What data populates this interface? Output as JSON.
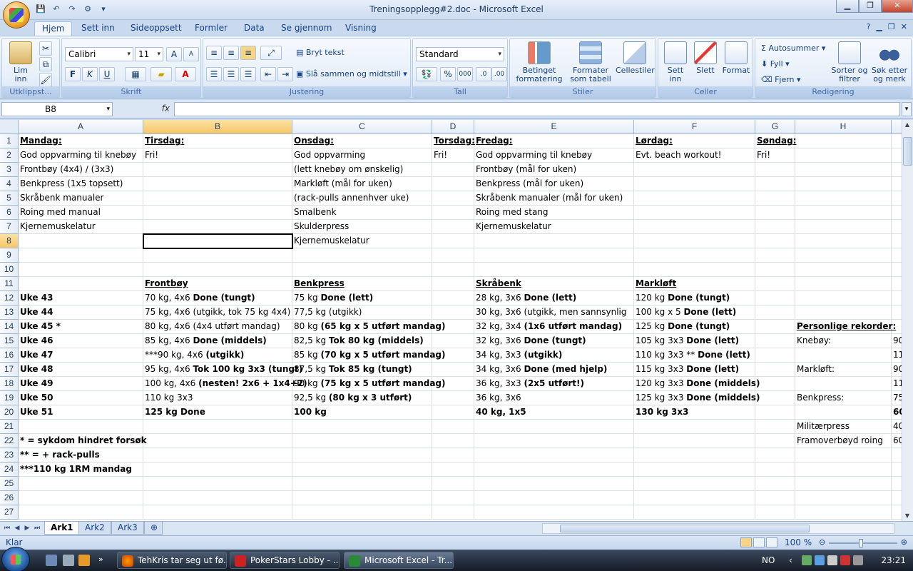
{
  "window": {
    "title": "Treningsopplegg#2.doc - Microsoft Excel",
    "min_label": "▁",
    "max_label": "❐",
    "close_label": "✕"
  },
  "qat": {
    "save": "💾",
    "undo": "↶",
    "redo": "↷",
    "custom": "⚙",
    "more": "▾"
  },
  "tabs": [
    "Hjem",
    "Sett inn",
    "Sideoppsett",
    "Formler",
    "Data",
    "Se gjennom",
    "Visning"
  ],
  "ribbon": {
    "clipboard": {
      "label": "Utklippst...",
      "paste": "Lim inn"
    },
    "font": {
      "label": "Skrift",
      "name": "Calibri",
      "size": "11",
      "bold": "F",
      "italic": "K",
      "underline": "U",
      "grow": "A",
      "shrink": "A"
    },
    "alignment": {
      "label": "Justering",
      "wrap": "Bryt tekst",
      "merge": "Slå sammen og midtstill"
    },
    "number": {
      "label": "Tall",
      "format": "Standard",
      "percent": "%",
      "thousands": "000"
    },
    "styles": {
      "label": "Stiler",
      "conditional": "Betinget formatering",
      "table": "Formater som tabell",
      "cell": "Cellestiler"
    },
    "cells": {
      "label": "Celler",
      "insert": "Sett inn",
      "delete": "Slett",
      "format": "Format"
    },
    "editing": {
      "label": "Redigering",
      "autosum": "Autosummer",
      "fill": "Fyll",
      "clear": "Fjern",
      "sort": "Sorter og filtrer",
      "find": "Søk etter og merk"
    }
  },
  "formula_bar": {
    "namebox": "B8",
    "fx": "fx",
    "value": ""
  },
  "columns": [
    "A",
    "B",
    "C",
    "D",
    "E",
    "F",
    "G",
    "H"
  ],
  "rows": [
    [
      "Mandag:",
      "Tirsdag:",
      "Onsdag:",
      "Torsdag:",
      "Fredag:",
      "Lørdag:",
      "Søndag:",
      "",
      ""
    ],
    [
      "God oppvarming til knebøy",
      "Fri!",
      "God oppvarming",
      "Fri!",
      "God oppvarming til knebøy",
      "Evt. beach workout!",
      "Fri!",
      "",
      ""
    ],
    [
      "Frontbøy (4x4) / (3x3)",
      "",
      "(lett knebøy om ønskelig)",
      "",
      "Frontbøy (mål for uken)",
      "",
      "",
      "",
      ""
    ],
    [
      "Benkpress (1x5 topsett)",
      "",
      "Markløft (mål for uken)",
      "",
      "Benkpress (mål for uken)",
      "",
      "",
      "",
      ""
    ],
    [
      "Skråbenk manualer",
      "",
      "(rack-pulls annenhver uke)",
      "",
      "Skråbenk manualer (mål for uken)",
      "",
      "",
      "",
      ""
    ],
    [
      "Roing med manual",
      "",
      "Smalbenk",
      "",
      "Roing med stang",
      "",
      "",
      "",
      ""
    ],
    [
      "Kjernemuskelatur",
      "",
      "Skulderpress",
      "",
      "Kjernemuskelatur",
      "",
      "",
      "",
      ""
    ],
    [
      "",
      "",
      "Kjernemuskelatur",
      "",
      "",
      "",
      "",
      "",
      ""
    ],
    [
      "",
      "",
      "",
      "",
      "",
      "",
      "",
      "",
      ""
    ],
    [
      "",
      "",
      "",
      "",
      "",
      "",
      "",
      "",
      ""
    ],
    [
      "",
      "Frontbøy",
      "Benkpress",
      "",
      "Skråbenk",
      "Markløft",
      "",
      "",
      ""
    ],
    [
      "Uke 43",
      "70 kg, 4x6 |Done (tungt)",
      "75 kg |Done (lett)",
      "",
      "28 kg, 3x6 |Done (lett)",
      "120 kg |Done (tungt)",
      "",
      "",
      ""
    ],
    [
      "Uke 44",
      "75 kg, 4x6 (utgikk, tok 75 kg 4x4)",
      "77,5 kg (utgikk)",
      "",
      "30 kg, 3x6 (utgikk, men sannsynlig",
      "100 kg x 5 |Done (lett)",
      "",
      "",
      ""
    ],
    [
      "Uke 45 *",
      "80 kg, 4x6 (4x4 utført mandag)",
      "80 kg |(65 kg x 5 utført mandag)",
      "",
      "32 kg, 3x4 |(1x6 utført mandag)",
      "125 kg |Done (tungt)",
      "",
      "Personlige rekorder:",
      ""
    ],
    [
      "Uke 46",
      "85 kg, 4x6 |Done (middels)",
      "82,5 kg |Tok 80 kg (middels)",
      "",
      "32 kg, 3x6 |Done (tungt)",
      "105 kg 3x3 |Done (lett)",
      "",
      "Knebøy:",
      "90"
    ],
    [
      "Uke 47",
      "***90 kg, 4x6 |(utgikk)",
      "85 kg |(70 kg x 5 utført mandag)",
      "",
      "34 kg, 3x3 |(utgikk)",
      "110 kg 3x3 ** |Done (lett)",
      "",
      "",
      "11"
    ],
    [
      "Uke 48",
      "95 kg, 4x6 |Tok 100 kg 3x3 (tungt)",
      "87,5 kg |Tok 85 kg (tungt)",
      "",
      "34 kg, 3x6 |Done (med hjelp)",
      "115 kg 3x3 |Done (lett)",
      "",
      "Markløft:",
      "90"
    ],
    [
      "Uke 49",
      "100 kg, 4x6 |(nesten! 2x6 + 1x4+2)",
      "90 kg |(75 kg x 5 utført mandag)",
      "",
      "36 kg, 3x3 |(2x5 utført!)",
      "120 kg 3x3 |Done (middels)",
      "",
      "",
      "11"
    ],
    [
      "Uke 50",
      "110 kg 3x3",
      "92,5 kg |(80 kg x 3 utført)",
      "",
      "36 kg, 3x6",
      "125 kg 3x3 |Done (middels)",
      "",
      "Benkpress:",
      "75"
    ],
    [
      "Uke 51",
      "125 kg Done",
      "100 kg",
      "",
      "40 kg, 1x5",
      "130 kg 3x3",
      "",
      "",
      "60"
    ],
    [
      "",
      "",
      "",
      "",
      "",
      "",
      "",
      "Militærpress",
      "40"
    ],
    [
      "* = sykdom hindret forsøk",
      "",
      "",
      "",
      "",
      "",
      "",
      "Framoverbøyd roing",
      "60"
    ],
    [
      "** = + rack-pulls",
      "",
      "",
      "",
      "",
      "",
      "",
      "",
      ""
    ],
    [
      "***110 kg 1RM mandag",
      "",
      "",
      "",
      "",
      "",
      "",
      "",
      ""
    ],
    [
      "",
      "",
      "",
      "",
      "",
      "",
      "",
      "",
      ""
    ],
    [
      "",
      "",
      "",
      "",
      "",
      "",
      "",
      "",
      ""
    ],
    [
      "",
      "",
      "",
      "",
      "",
      "",
      "",
      "",
      ""
    ]
  ],
  "row_numbers": [
    "1",
    "2",
    "3",
    "4",
    "5",
    "6",
    "7",
    "8",
    "9",
    "10",
    "11",
    "12",
    "13",
    "14",
    "15",
    "16",
    "17",
    "18",
    "19",
    "20",
    "21",
    "22",
    "23",
    "24",
    "25",
    "26",
    "27"
  ],
  "sheets": [
    "Ark1",
    "Ark2",
    "Ark3"
  ],
  "status": {
    "text": "Klar",
    "zoom": "100 %"
  },
  "taskbar": {
    "tasks": [
      "TehKris tar seg ut fø...",
      "PokerStars Lobby - ...",
      "Microsoft Excel - Tr..."
    ],
    "lang": "NO",
    "clock": "23:21"
  },
  "colors": {
    "accent": "#15428b",
    "selected_header": "#f7c668"
  }
}
